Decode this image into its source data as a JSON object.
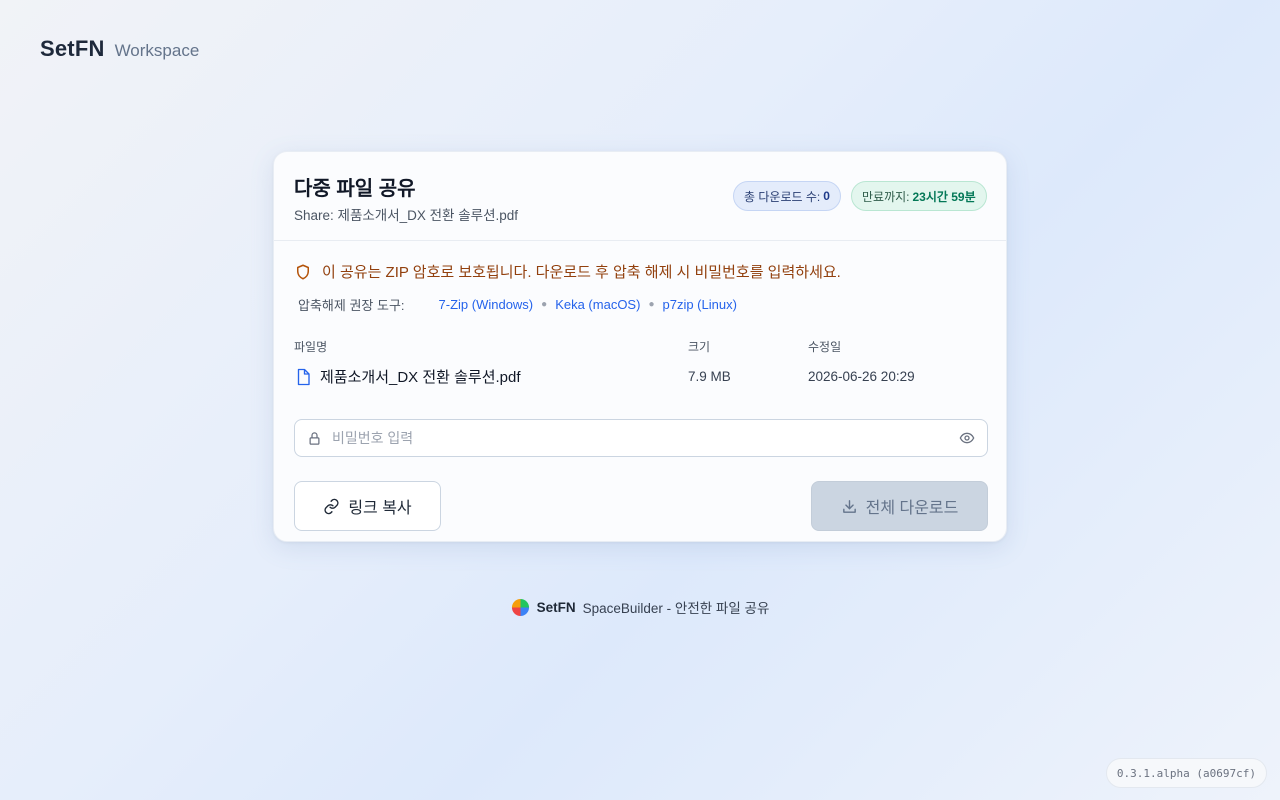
{
  "brand": {
    "name": "SetFN",
    "subtitle": "Workspace"
  },
  "card": {
    "title": "다중 파일 공유",
    "share_label": "Share: 제품소개서_DX 전환 솔루션.pdf",
    "badges": {
      "downloads_label": "총 다운로드 수:",
      "downloads_value": "0",
      "expiry_label": "만료까지:",
      "expiry_value": "23시간 59분"
    },
    "notice": "이 공유는 ZIP 암호로 보호됩니다. 다운로드 후 압축 해제 시 비밀번호를 입력하세요.",
    "tools": {
      "label": "압축해제 권장 도구:",
      "links": [
        "7-Zip (Windows)",
        "Keka (macOS)",
        "p7zip (Linux)"
      ]
    },
    "table": {
      "headers": {
        "name": "파일명",
        "size": "크기",
        "modified": "수정일"
      },
      "rows": [
        {
          "name": "제품소개서_DX 전환 솔루션.pdf",
          "size": "7.9 MB",
          "modified": "2026-06-26 20:29",
          "icon": "file-icon"
        }
      ]
    },
    "password": {
      "placeholder": "비밀번호 입력",
      "value": ""
    },
    "buttons": {
      "copy_link": "링크 복사",
      "download_all": "전체 다운로드"
    }
  },
  "footer": {
    "brand": "SetFN",
    "text": "SpaceBuilder - 안전한 파일 공유"
  },
  "version": "0.3.1.alpha (a0697cf)",
  "colors": {
    "accent": "#2563eb",
    "warning": "#92400e",
    "success": "#047857",
    "disabled_button": "#cbd5e1"
  }
}
